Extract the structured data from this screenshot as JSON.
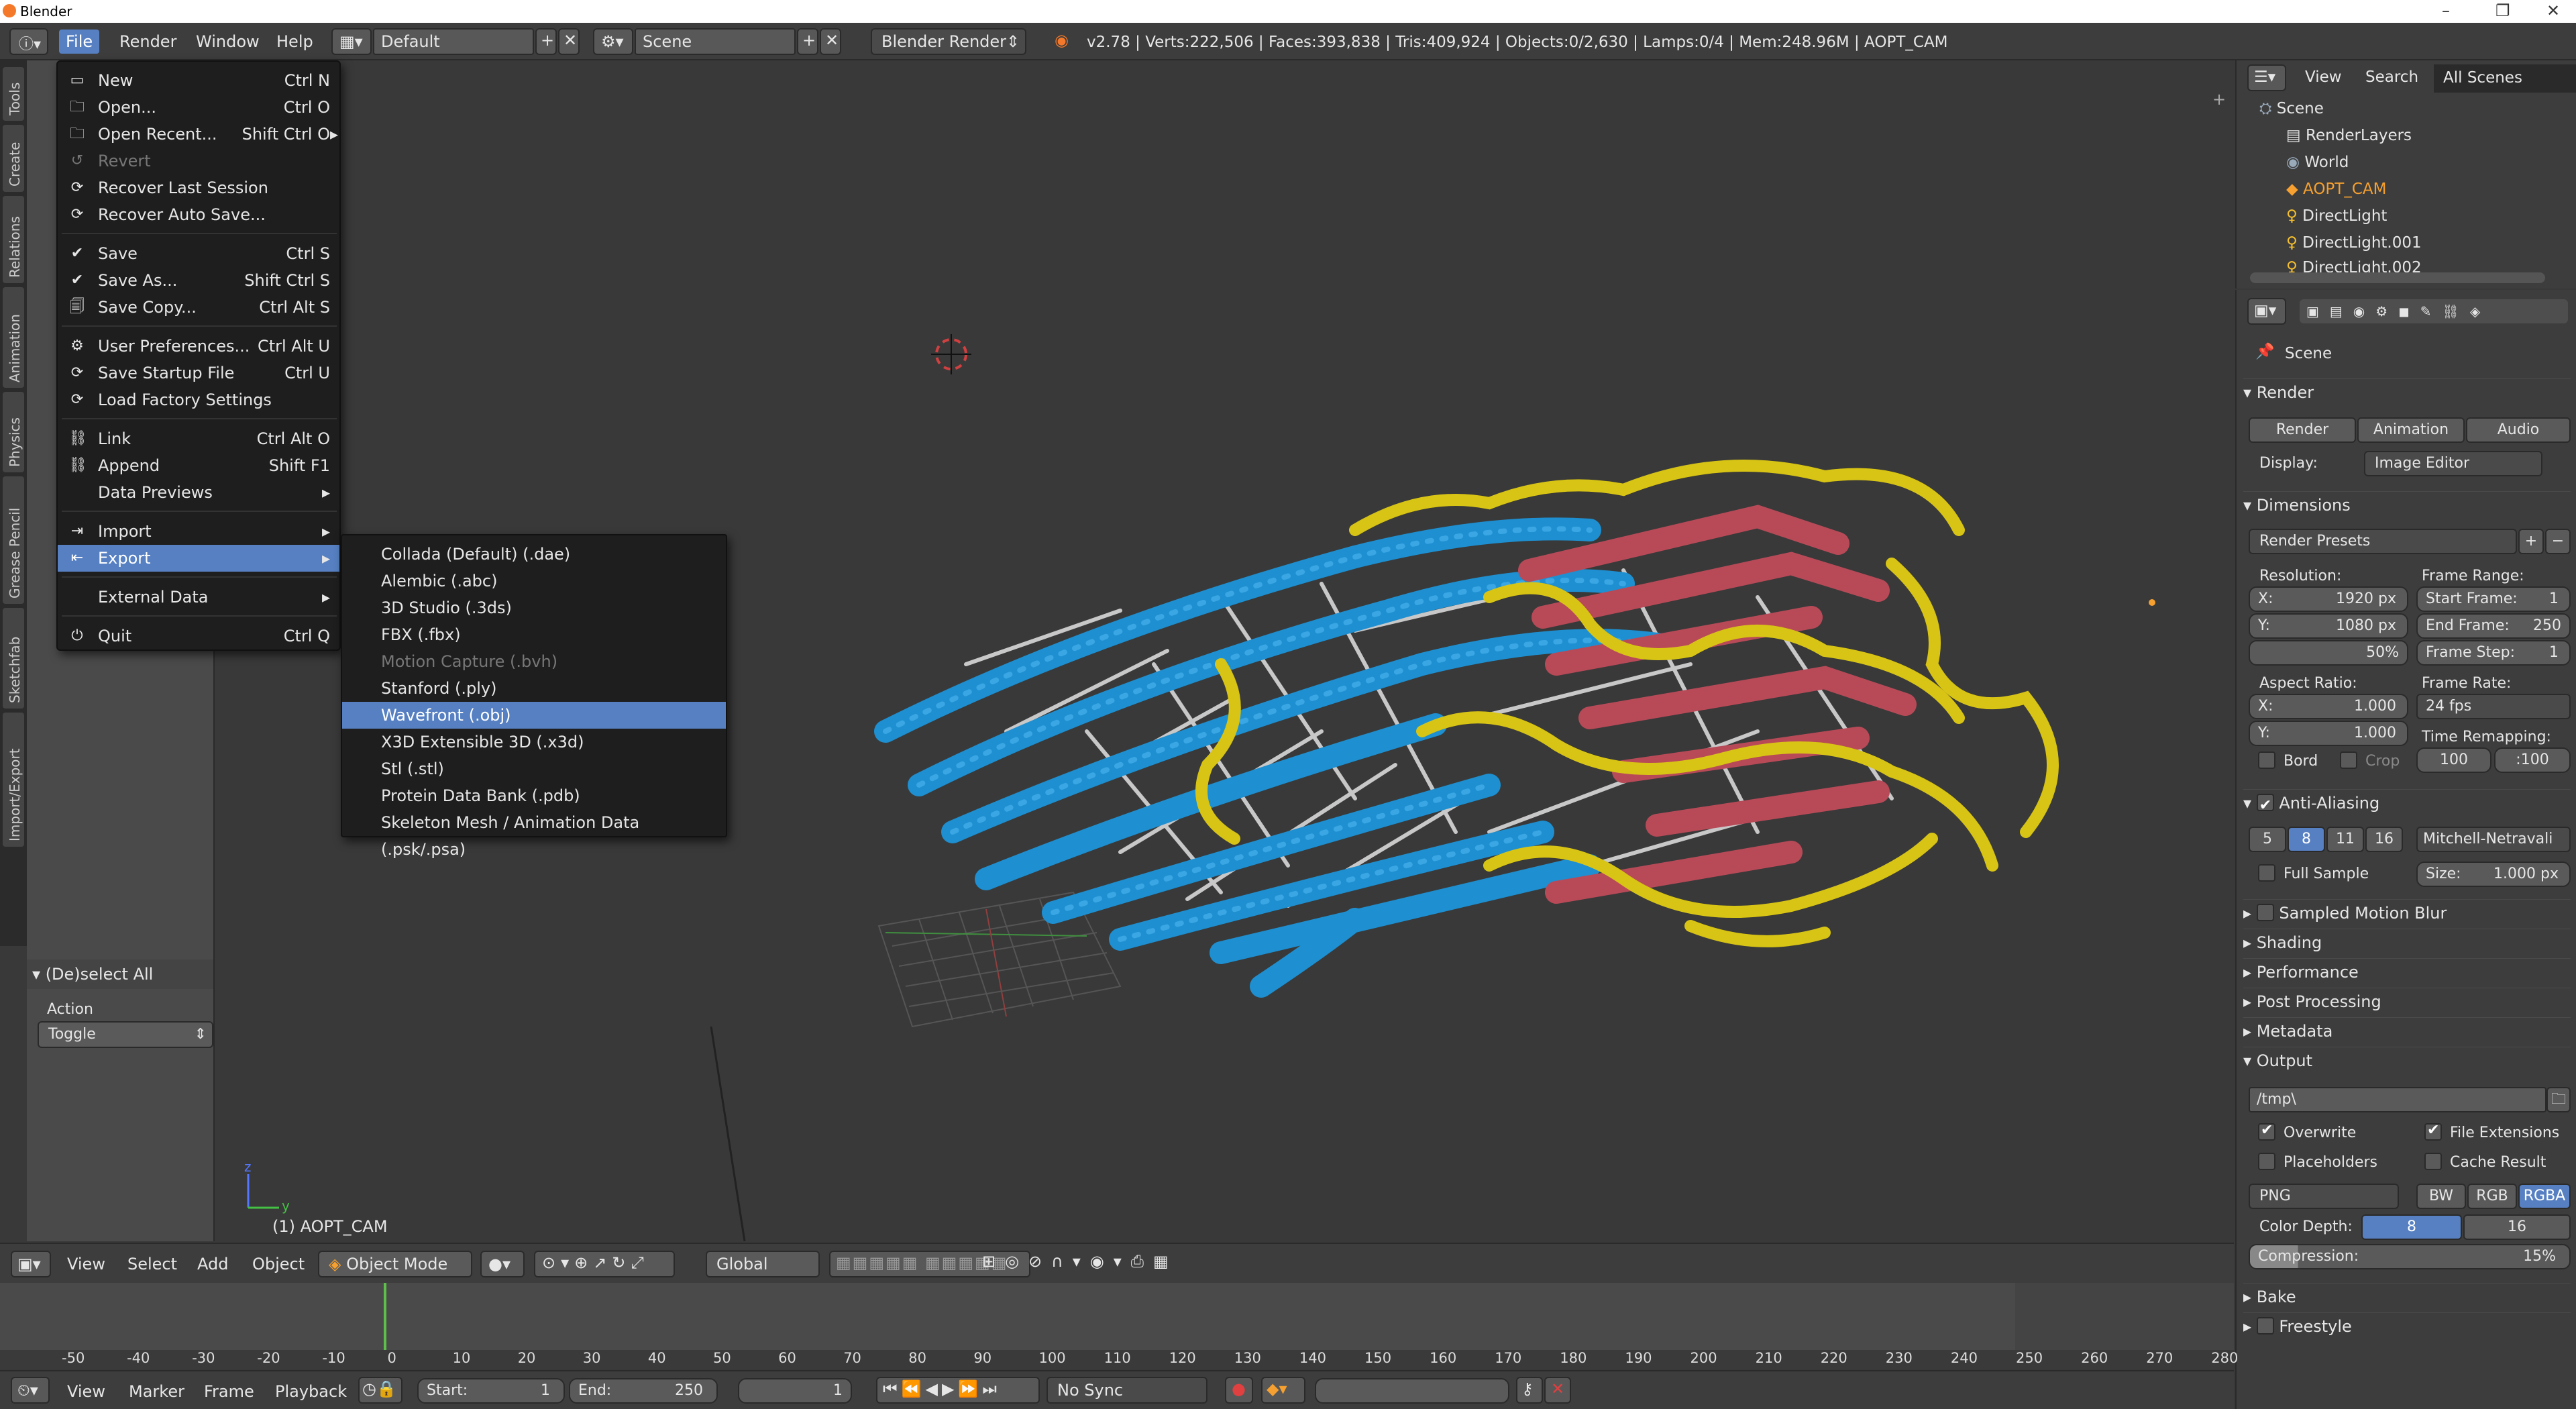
{
  "window": {
    "title": "Blender"
  },
  "info_header": {
    "menus": [
      "File",
      "Render",
      "Window",
      "Help"
    ],
    "layout_name": "Default",
    "scene_name": "Scene",
    "render_engine": "Blender Render",
    "stats": "v2.78 | Verts:222,506 | Faces:393,838 | Tris:409,924 | Objects:0/2,630 | Lamps:0/4 | Mem:248.96M | AOPT_CAM"
  },
  "left_tabs": [
    "Tools",
    "Create",
    "Relations",
    "Animation",
    "Physics",
    "Grease Pencil",
    "Sketchfab",
    "Import/Export"
  ],
  "operator_panel": {
    "title": "(De)select All",
    "action_label": "Action",
    "action_value": "Toggle"
  },
  "file_menu": [
    {
      "label": "New",
      "shortcut": "Ctrl N",
      "icon": "new-file-icon"
    },
    {
      "label": "Open...",
      "shortcut": "Ctrl O",
      "icon": "folder-icon"
    },
    {
      "label": "Open Recent...",
      "shortcut": "Shift Ctrl O",
      "icon": "recent-icon",
      "arrow": true
    },
    {
      "label": "Revert",
      "shortcut": "",
      "icon": "revert-icon",
      "disabled": true
    },
    {
      "label": "Recover Last Session",
      "shortcut": "",
      "icon": "recover-icon"
    },
    {
      "label": "Recover Auto Save...",
      "shortcut": "",
      "icon": "recover-icon"
    },
    {
      "label": "Save",
      "shortcut": "Ctrl S",
      "icon": "check-icon",
      "sep_before": true
    },
    {
      "label": "Save As...",
      "shortcut": "Shift Ctrl S",
      "icon": "check-icon"
    },
    {
      "label": "Save Copy...",
      "shortcut": "Ctrl Alt S",
      "icon": "save-copy-icon"
    },
    {
      "label": "User Preferences...",
      "shortcut": "Ctrl Alt U",
      "icon": "preferences-icon",
      "sep_before": true
    },
    {
      "label": "Save Startup File",
      "shortcut": "Ctrl U",
      "icon": "startup-icon"
    },
    {
      "label": "Load Factory Settings",
      "shortcut": "",
      "icon": "factory-icon"
    },
    {
      "label": "Link",
      "shortcut": "Ctrl Alt O",
      "icon": "link-icon",
      "sep_before": true
    },
    {
      "label": "Append",
      "shortcut": "Shift F1",
      "icon": "append-icon"
    },
    {
      "label": "Data Previews",
      "shortcut": "",
      "icon": "",
      "arrow": true
    },
    {
      "label": "Import",
      "shortcut": "",
      "icon": "import-icon",
      "arrow": true,
      "sep_before": true
    },
    {
      "label": "Export",
      "shortcut": "",
      "icon": "export-icon",
      "arrow": true,
      "highlighted": true
    },
    {
      "label": "External Data",
      "shortcut": "",
      "icon": "",
      "arrow": true,
      "sep_before": true
    },
    {
      "label": "Quit",
      "shortcut": "Ctrl Q",
      "icon": "power-icon",
      "sep_before": true
    }
  ],
  "export_submenu": [
    {
      "label": "Collada (Default) (.dae)"
    },
    {
      "label": "Alembic (.abc)"
    },
    {
      "label": "3D Studio (.3ds)"
    },
    {
      "label": "FBX (.fbx)"
    },
    {
      "label": "Motion Capture (.bvh)",
      "disabled": true
    },
    {
      "label": "Stanford (.ply)"
    },
    {
      "label": "Wavefront (.obj)",
      "highlighted": true
    },
    {
      "label": "X3D Extensible 3D (.x3d)"
    },
    {
      "label": "Stl (.stl)"
    },
    {
      "label": "Protein Data Bank (.pdb)"
    },
    {
      "label": "Skeleton Mesh / Animation Data (.psk/.psa)"
    }
  ],
  "viewport": {
    "object_label": "(1) AOPT_CAM"
  },
  "viewport_header": {
    "menus": [
      "View",
      "Select",
      "Add",
      "Object"
    ],
    "mode": "Object Mode",
    "orientation": "Global"
  },
  "timeline": {
    "ticks": [
      "-50",
      "-40",
      "-30",
      "-20",
      "-10",
      "0",
      "10",
      "20",
      "30",
      "40",
      "50",
      "60",
      "70",
      "80",
      "90",
      "100",
      "110",
      "120",
      "130",
      "140",
      "150",
      "160",
      "170",
      "180",
      "190",
      "200",
      "210",
      "220",
      "230",
      "240",
      "250",
      "260",
      "270",
      "280"
    ],
    "menus": [
      "View",
      "Marker",
      "Frame",
      "Playback"
    ],
    "start_label": "Start:",
    "start_value": "1",
    "end_label": "End:",
    "end_value": "250",
    "current_frame": "1",
    "sync": "No Sync"
  },
  "outliner": {
    "header_menus": [
      "View",
      "Search"
    ],
    "filter": "All Scenes",
    "rows": [
      "Scene",
      "RenderLayers",
      "World",
      "AOPT_CAM",
      "DirectLight",
      "DirectLight.001",
      "DirectLight.002"
    ]
  },
  "properties": {
    "context": "Scene",
    "render_section": "Render",
    "render_buttons": [
      "Render",
      "Animation",
      "Audio"
    ],
    "display_label": "Display:",
    "display_value": "Image Editor",
    "dimensions": "Dimensions",
    "render_presets": "Render Presets",
    "resolution_label": "Resolution:",
    "res_x": "X:",
    "res_x_val": "1920 px",
    "res_y": "Y:",
    "res_y_val": "1080 px",
    "res_pct": "50%",
    "frame_range_label": "Frame Range:",
    "start_frame": "Start Frame:",
    "start_frame_val": "1",
    "end_frame": "End Frame:",
    "end_frame_val": "250",
    "frame_step": "Frame Step:",
    "frame_step_val": "1",
    "aspect_label": "Aspect Ratio:",
    "asp_x": "X:",
    "asp_x_val": "1.000",
    "asp_y": "Y:",
    "asp_y_val": "1.000",
    "frame_rate_label": "Frame Rate:",
    "frame_rate": "24 fps",
    "time_remap_label": "Time Remapping:",
    "remap_old": "100",
    "remap_new": ":100",
    "bord": "Bord",
    "crop": "Crop",
    "anti_aliasing": "Anti-Aliasing",
    "aa_samples": [
      "5",
      "8",
      "11",
      "16"
    ],
    "aa_selected": "8",
    "aa_filter": "Mitchell-Netravali",
    "full_sample": "Full Sample",
    "size_label": "Size:",
    "size_val": "1.000 px",
    "sampled_motion_blur": "Sampled Motion Blur",
    "shading": "Shading",
    "performance": "Performance",
    "post_processing": "Post Processing",
    "metadata": "Metadata",
    "output": "Output",
    "output_path": "/tmp\\",
    "overwrite": "Overwrite",
    "file_extensions": "File Extensions",
    "placeholders": "Placeholders",
    "cache_result": "Cache Result",
    "file_format": "PNG",
    "color_modes": [
      "BW",
      "RGB",
      "RGBA"
    ],
    "color_mode_selected": "RGBA",
    "color_depth_label": "Color Depth:",
    "color_depths": [
      "8",
      "16"
    ],
    "compression_label": "Compression:",
    "compression_val": "15%",
    "bake": "Bake",
    "freestyle": "Freestyle"
  },
  "colors": {
    "accent": "#5680c2",
    "helix": "#1e8fd0",
    "sheet": "#b84a58",
    "coil": "#d8c414"
  }
}
